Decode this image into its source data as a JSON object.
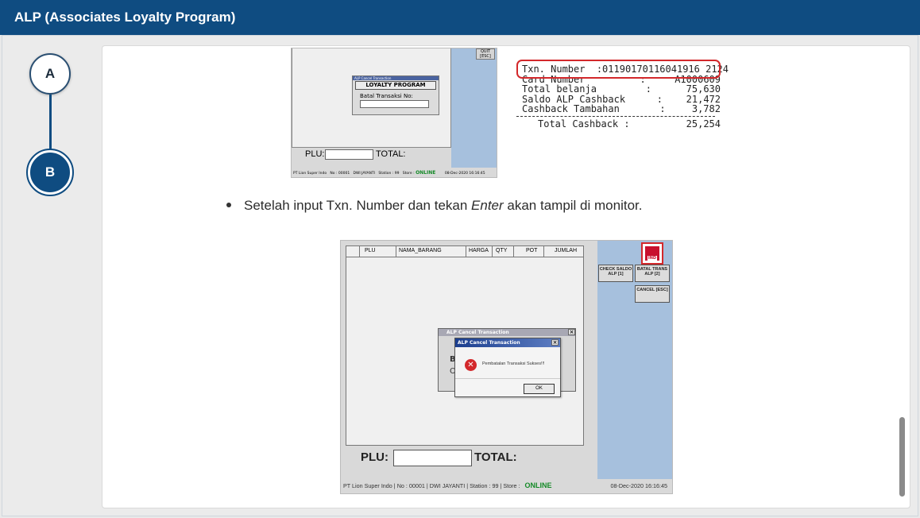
{
  "header": {
    "title": "ALP (Associates Loyalty Program)"
  },
  "steps": [
    {
      "label": "A"
    },
    {
      "label": "B"
    }
  ],
  "screenshot1": {
    "esc_btn": "QUIT [ESC]",
    "dialog_title": "ALP Cancel Transaction",
    "dialog_header": "LOYALTY PROGRAM",
    "dialog_label": "Batal Transaksi  No:",
    "plu_label": "PLU:",
    "total_label": "TOTAL:",
    "status": {
      "company": "PT Lion Super Indo",
      "no": "No : 00001",
      "user": "DWI JAYANTI",
      "station": "Station : 99",
      "store": "Store :",
      "online": "ONLINE",
      "datetime": "08-Dec-2020 16:16:45"
    }
  },
  "receipt": {
    "rows": [
      {
        "label": "Txn. Number",
        "value": ":01190170116041916 2124"
      },
      {
        "label": "Card Number",
        "value": "A1000609"
      },
      {
        "label": "Total belanja",
        "value": "75,630"
      },
      {
        "label": "Saldo ALP Cashback",
        "value": "21,472"
      },
      {
        "label": "Cashback Tambahan",
        "value": "3,782"
      }
    ],
    "total_label": "Total Cashback :",
    "total_value": "25,254"
  },
  "instruction": {
    "pre": "Setelah input Txn. Number dan tekan ",
    "emph": "Enter",
    "post": " akan tampil di monitor."
  },
  "screenshot2": {
    "columns": [
      "PLU",
      "NAMA_BARANG",
      "HARGA",
      "QTY",
      "POT",
      "JUMLAH"
    ],
    "logo_text": "IND",
    "buttons": [
      "CHECK SALDO ALP [1]",
      "BATAL TRANS ALP [2]",
      "CANCEL [ESC]"
    ],
    "back_dialog": {
      "title": "ALP Cancel Transaction",
      "close": "×",
      "b_text": "B",
      "o_text": "O"
    },
    "front_dialog": {
      "title": "ALP Cancel Transaction",
      "close": "×",
      "message": "Pembatalan Transaksi Sukses!!!",
      "ok": "OK",
      "error_glyph": "✕"
    },
    "plu_label": "PLU:",
    "total_label": "TOTAL:",
    "status": {
      "company": "PT Lion Super Indo",
      "no": "No : 00001",
      "user": "DWI JAYANTI",
      "station": "Station : 99",
      "store": "Store :",
      "online": "ONLINE",
      "datetime": "08-Dec-2020 16:16:45"
    }
  },
  "colors": {
    "header_bg": "#0f4c81",
    "accent": "#0f4c81",
    "highlight": "#d3282b",
    "online": "#158a28",
    "pos_panel": "#a6c0dd"
  }
}
